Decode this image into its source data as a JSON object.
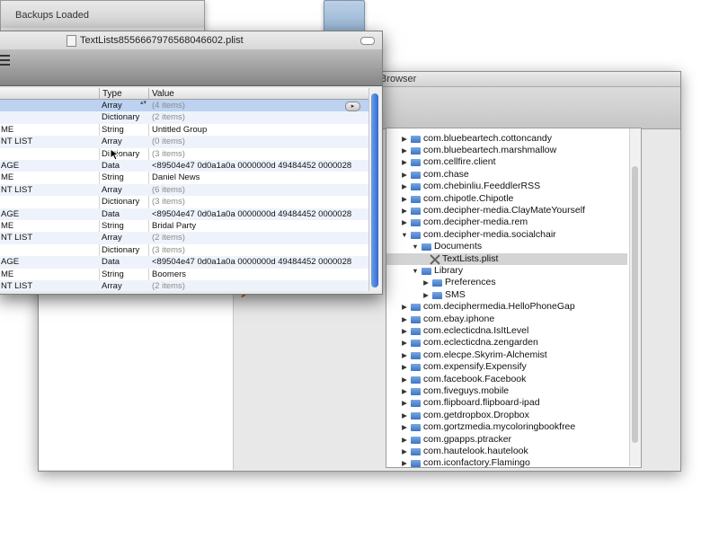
{
  "backups_window": {
    "title": "Backups Loaded"
  },
  "browser_window": {
    "title": "Browser"
  },
  "plist_window": {
    "title": "TextLists8556667976568046602.plist",
    "columns": {
      "type": "Type",
      "value": "Value"
    },
    "rows": [
      {
        "key": "",
        "type": "Array",
        "value": "(4 items)"
      },
      {
        "key": "",
        "type": "Dictionary",
        "value": "(2 items)"
      },
      {
        "key": "ME",
        "type": "String",
        "value": "Untitled Group"
      },
      {
        "key": "NT LIST",
        "type": "Array",
        "value": "(0 items)"
      },
      {
        "key": "",
        "type": "Dictionary",
        "value": "(3 items)"
      },
      {
        "key": "AGE",
        "type": "Data",
        "value": "<89504e47 0d0a1a0a 0000000d 49484452 0000028"
      },
      {
        "key": "ME",
        "type": "String",
        "value": "Daniel News"
      },
      {
        "key": "NT LIST",
        "type": "Array",
        "value": "(6 items)"
      },
      {
        "key": "",
        "type": "Dictionary",
        "value": "(3 items)"
      },
      {
        "key": "AGE",
        "type": "Data",
        "value": "<89504e47 0d0a1a0a 0000000d 49484452 0000028"
      },
      {
        "key": "ME",
        "type": "String",
        "value": "Bridal Party"
      },
      {
        "key": "NT LIST",
        "type": "Array",
        "value": "(2 items)"
      },
      {
        "key": "",
        "type": "Dictionary",
        "value": "(3 items)"
      },
      {
        "key": "AGE",
        "type": "Data",
        "value": "<89504e47 0d0a1a0a 0000000d 49484452 0000028"
      },
      {
        "key": "ME",
        "type": "String",
        "value": "Boomers"
      },
      {
        "key": "NT LIST",
        "type": "Array",
        "value": "(2 items)"
      }
    ]
  },
  "tree": {
    "items": [
      {
        "label": "com.bluebeartech.cottoncandy",
        "depth": 0,
        "expanded": false,
        "kind": "folder"
      },
      {
        "label": "com.bluebeartech.marshmallow",
        "depth": 0,
        "expanded": false,
        "kind": "folder"
      },
      {
        "label": "com.cellfire.client",
        "depth": 0,
        "expanded": false,
        "kind": "folder"
      },
      {
        "label": "com.chase",
        "depth": 0,
        "expanded": false,
        "kind": "folder"
      },
      {
        "label": "com.chebinliu.FeeddlerRSS",
        "depth": 0,
        "expanded": false,
        "kind": "folder"
      },
      {
        "label": "com.chipotle.Chipotle",
        "depth": 0,
        "expanded": false,
        "kind": "folder"
      },
      {
        "label": "com.decipher-media.ClayMateYourself",
        "depth": 0,
        "expanded": false,
        "kind": "folder"
      },
      {
        "label": "com.decipher-media.rem",
        "depth": 0,
        "expanded": false,
        "kind": "folder"
      },
      {
        "label": "com.decipher-media.socialchair",
        "depth": 0,
        "expanded": true,
        "kind": "folder"
      },
      {
        "label": "Documents",
        "depth": 1,
        "expanded": true,
        "kind": "folder"
      },
      {
        "label": "TextLists.plist",
        "depth": 2,
        "expanded": null,
        "kind": "file"
      },
      {
        "label": "Library",
        "depth": 1,
        "expanded": true,
        "kind": "folder"
      },
      {
        "label": "Preferences",
        "depth": 2,
        "expanded": false,
        "kind": "folder"
      },
      {
        "label": "SMS",
        "depth": 2,
        "expanded": false,
        "kind": "folder"
      },
      {
        "label": "com.deciphermedia.HelloPhoneGap",
        "depth": 0,
        "expanded": false,
        "kind": "folder"
      },
      {
        "label": "com.ebay.iphone",
        "depth": 0,
        "expanded": false,
        "kind": "folder"
      },
      {
        "label": "com.eclecticdna.IsItLevel",
        "depth": 0,
        "expanded": false,
        "kind": "folder"
      },
      {
        "label": "com.eclecticdna.zengarden",
        "depth": 0,
        "expanded": false,
        "kind": "folder"
      },
      {
        "label": "com.elecpe.Skyrim-Alchemist",
        "depth": 0,
        "expanded": false,
        "kind": "folder"
      },
      {
        "label": "com.expensify.Expensify",
        "depth": 0,
        "expanded": false,
        "kind": "folder"
      },
      {
        "label": "com.facebook.Facebook",
        "depth": 0,
        "expanded": false,
        "kind": "folder"
      },
      {
        "label": "com.fiveguys.mobile",
        "depth": 0,
        "expanded": false,
        "kind": "folder"
      },
      {
        "label": "com.flipboard.flipboard-ipad",
        "depth": 0,
        "expanded": false,
        "kind": "folder"
      },
      {
        "label": "com.getdropbox.Dropbox",
        "depth": 0,
        "expanded": false,
        "kind": "folder"
      },
      {
        "label": "com.gortzmedia.mycoloringbookfree",
        "depth": 0,
        "expanded": false,
        "kind": "folder"
      },
      {
        "label": "com.gpapps.ptracker",
        "depth": 0,
        "expanded": false,
        "kind": "folder"
      },
      {
        "label": "com.hautelook.hautelook",
        "depth": 0,
        "expanded": false,
        "kind": "folder"
      },
      {
        "label": "com.iconfactory.Flamingo",
        "depth": 0,
        "expanded": false,
        "kind": "folder"
      }
    ]
  }
}
